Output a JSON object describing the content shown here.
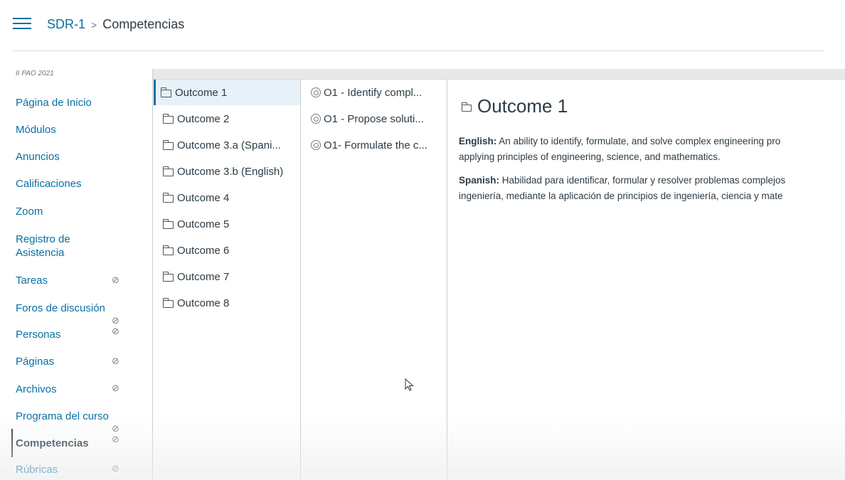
{
  "header": {
    "course": "SDR-1",
    "separator": ">",
    "current": "Competencias"
  },
  "nav": {
    "term": "II PAO 2021",
    "items": [
      {
        "label": "Página de Inicio",
        "hidden": false
      },
      {
        "label": "Módulos",
        "hidden": false
      },
      {
        "label": "Anuncios",
        "hidden": false
      },
      {
        "label": "Calificaciones",
        "hidden": false
      },
      {
        "label": "Zoom",
        "hidden": false
      },
      {
        "label": "Registro de Asistencia",
        "hidden": false
      },
      {
        "label": "Tareas",
        "hidden": true
      },
      {
        "label": "Foros de discusión",
        "hidden": true
      },
      {
        "label": "Personas",
        "hidden": true
      },
      {
        "label": "Páginas",
        "hidden": true
      },
      {
        "label": "Archivos",
        "hidden": true
      },
      {
        "label": "Programa del curso",
        "hidden": true
      },
      {
        "label": "Competencias",
        "hidden": true,
        "active": true
      },
      {
        "label": "Rúbricas",
        "hidden": true
      }
    ]
  },
  "outcome_groups": [
    "Outcome 1",
    "Outcome 2",
    "Outcome 3.a (Spani...",
    "Outcome 3.b (English)",
    "Outcome 4",
    "Outcome 5",
    "Outcome 6",
    "Outcome 7",
    "Outcome 8"
  ],
  "selected_group": "Outcome 1",
  "outcomes": [
    "O1 - Identify compl...",
    "O1 - Propose soluti...",
    "O1- Formulate the c..."
  ],
  "detail": {
    "title": "Outcome 1",
    "english_label": "English:",
    "english_line1": "An ability to identify, formulate, and solve complex engineering pro",
    "english_line2": "applying principles of engineering, science, and mathematics.",
    "spanish_label": "Spanish:",
    "spanish_line1": "Habilidad para identificar, formular y resolver problemas complejos",
    "spanish_line2": "ingeniería, mediante la aplicación de principios de ingeniería, ciencia y mate"
  },
  "colors": {
    "link": "#0770a3",
    "text": "#2d3b45",
    "selected_bg": "#e7f1f8"
  }
}
